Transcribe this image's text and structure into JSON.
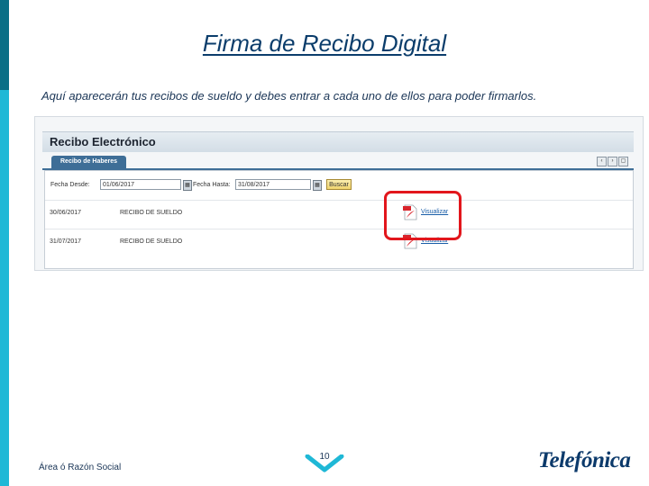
{
  "slide": {
    "title": "Firma de Recibo Digital",
    "intro": "Aquí aparecerán tus recibos de sueldo y debes entrar a cada uno de ellos para poder firmarlos.",
    "footer_left": "Área ó Razón Social",
    "page_number": "10",
    "logo_text": "Telefónica"
  },
  "app": {
    "header_title": "Recibo Electrónico",
    "tab_label": "Recibo de Haberes",
    "window_buttons": [
      "‹",
      "›",
      "▢"
    ],
    "filter": {
      "from_label": "Fecha Desde:",
      "from_value": "01/06/2017",
      "to_label": "Fecha Hasta:",
      "to_value": "31/08/2017",
      "search_label": "Buscar"
    },
    "rows": [
      {
        "date": "30/06/2017",
        "concept": "RECIBO DE SUELDO",
        "action": "Visualizar"
      },
      {
        "date": "31/07/2017",
        "concept": "RECIBO DE SUELDO",
        "action": "Visualizar"
      }
    ]
  },
  "colors": {
    "accent": "#1fb8d6",
    "title": "#0b3d6b",
    "highlight": "#e2161c"
  }
}
